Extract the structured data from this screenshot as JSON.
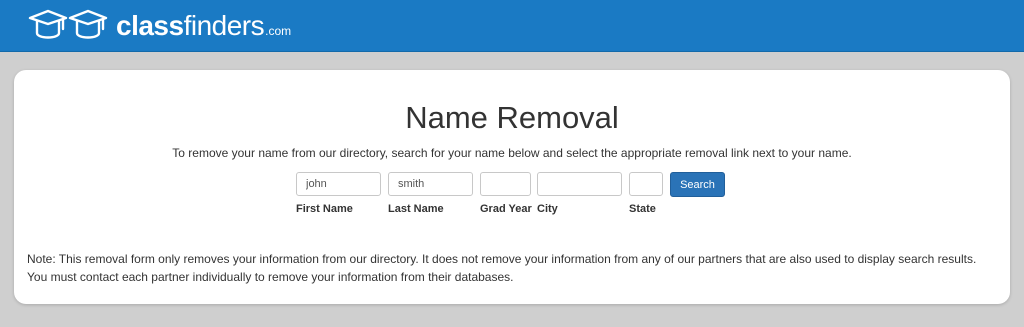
{
  "header": {
    "brand_bold": "class",
    "brand_light": "finders",
    "brand_suffix": ".com"
  },
  "page": {
    "title": "Name Removal",
    "intro": "To remove your name from our directory, search for your name below and select the appropriate removal link next to your name."
  },
  "form": {
    "first_name": {
      "label": "First Name",
      "value": "john"
    },
    "last_name": {
      "label": "Last Name",
      "value": "smith"
    },
    "grad_year": {
      "label": "Grad Year",
      "value": ""
    },
    "city": {
      "label": "City",
      "value": ""
    },
    "state": {
      "label": "State",
      "value": ""
    },
    "search_label": "Search"
  },
  "note": "Note: This removal form only removes your information from our directory. It does not remove your information from any of our partners that are also used to display search results. You must contact each partner individually to remove your information from their databases.",
  "colors": {
    "header_bg": "#1a7ac4",
    "button_bg": "#2a73b7",
    "page_bg": "#cfcfcf"
  }
}
